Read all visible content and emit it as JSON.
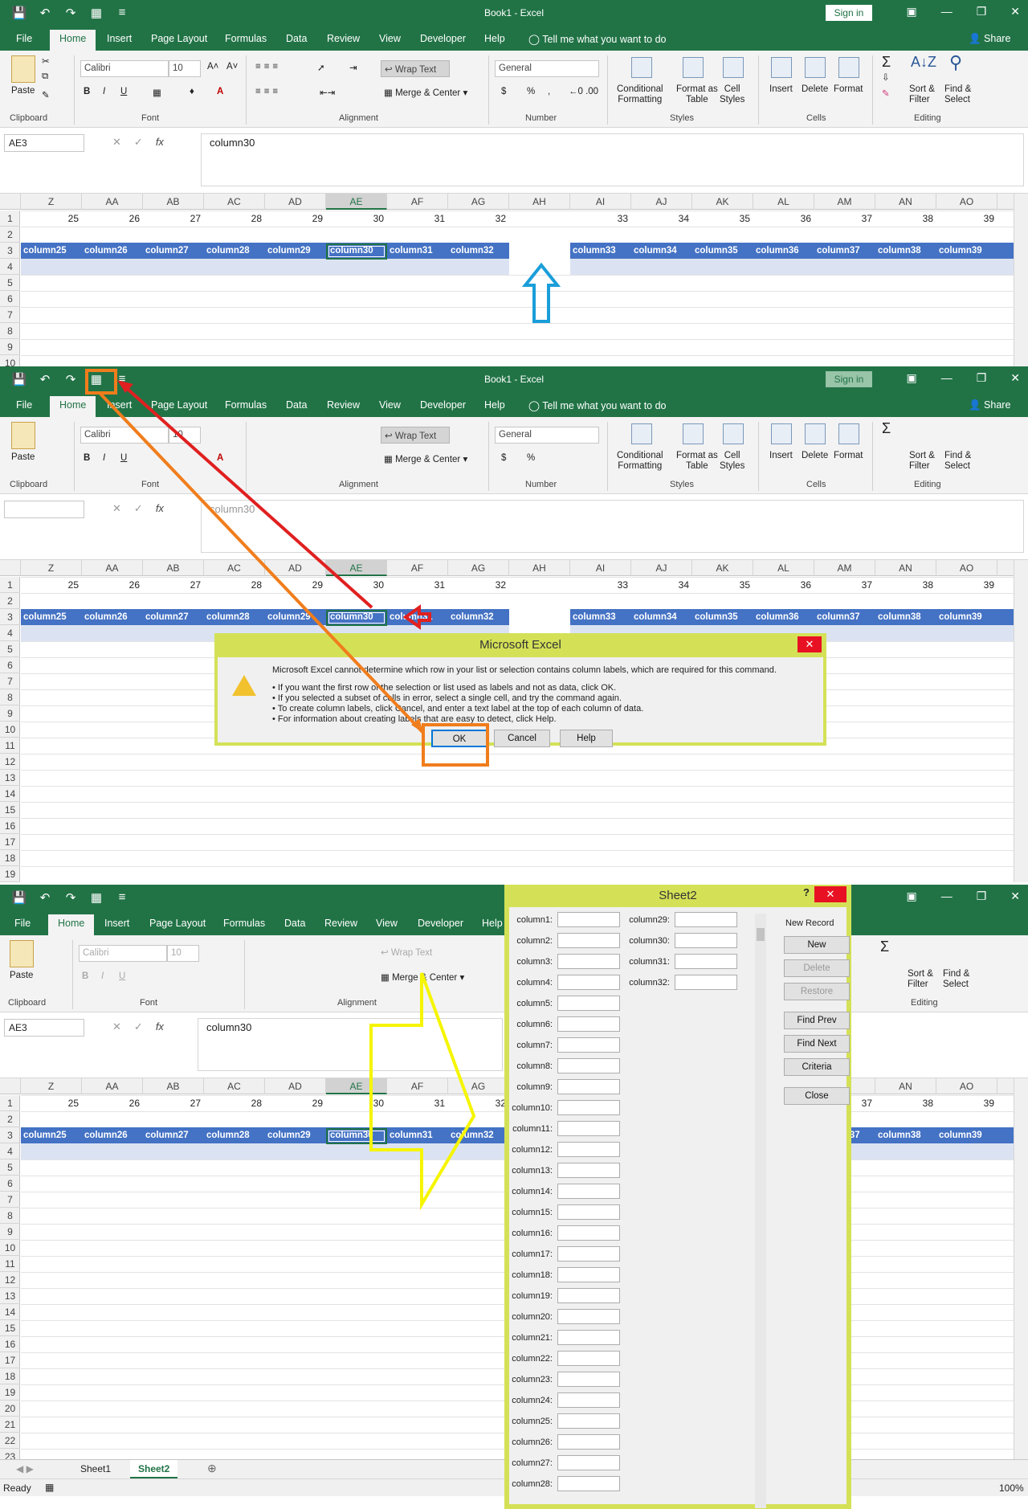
{
  "app": {
    "doc_title": "Book1  -  Excel",
    "sign_in": "Sign in",
    "share": "Share",
    "tell_me": "Tell me what you want to do",
    "tabs": [
      "File",
      "Home",
      "Insert",
      "Page Layout",
      "Formulas",
      "Data",
      "Review",
      "View",
      "Developer",
      "Help"
    ]
  },
  "ribbon": {
    "paste": "Paste",
    "font_name": "Calibri",
    "font_size": "10",
    "bold": "B",
    "italic": "I",
    "underline": "U",
    "wrap_text": "Wrap Text",
    "merge_center": "Merge & Center",
    "number_format": "General",
    "currency": "$",
    "percent": "%",
    "comma": ",",
    "conditional_formatting": [
      "Conditional",
      "Formatting"
    ],
    "format_as_table": [
      "Format as",
      "Table"
    ],
    "cell_styles": [
      "Cell",
      "Styles"
    ],
    "insert": "Insert",
    "delete": "Delete",
    "format": "Format",
    "sort_filter": [
      "Sort &",
      "Filter"
    ],
    "find_select": [
      "Find &",
      "Select"
    ],
    "groups": {
      "clipboard": "Clipboard",
      "font": "Font",
      "alignment": "Alignment",
      "number": "Number",
      "styles": "Styles",
      "cells": "Cells",
      "editing": "Editing"
    }
  },
  "formula_bar": {
    "name_box": "AE3",
    "fx": "fx",
    "content": "column30"
  },
  "grid": {
    "columns": [
      "Z",
      "AA",
      "AB",
      "AC",
      "AD",
      "AE",
      "AF",
      "AG",
      "AH",
      "AI",
      "AJ",
      "AK",
      "AL",
      "AM",
      "AN",
      "AO"
    ],
    "row1_values": [
      "25",
      "26",
      "27",
      "28",
      "29",
      "30",
      "31",
      "32",
      "",
      "33",
      "34",
      "35",
      "36",
      "37",
      "38",
      "39"
    ],
    "row3_labels": [
      "column25",
      "column26",
      "column27",
      "column28",
      "column29",
      "column30",
      "column31",
      "column32",
      "",
      "column33",
      "column34",
      "column35",
      "column36",
      "column37",
      "column38",
      "column39"
    ],
    "row_numbers_p1": [
      "1",
      "2",
      "3",
      "4",
      "5",
      "6",
      "7",
      "8",
      "9",
      "10"
    ],
    "row_numbers_p2": [
      "1",
      "2",
      "3",
      "4",
      "5",
      "6",
      "7",
      "8",
      "9",
      "10",
      "11",
      "12",
      "13",
      "14",
      "15",
      "16",
      "17",
      "18",
      "19"
    ],
    "row_numbers_p3": [
      "1",
      "2",
      "3",
      "4",
      "5",
      "6",
      "7",
      "8",
      "9",
      "10",
      "11",
      "12",
      "13",
      "14",
      "15",
      "16",
      "17",
      "18",
      "19",
      "20",
      "21",
      "22",
      "23"
    ]
  },
  "error_dialog": {
    "title": "Microsoft Excel",
    "main_text": "Microsoft Excel cannot determine which row in your list or selection contains column labels, which are required for this command.",
    "bullets": [
      "• If you want the first row of the selection or list used as labels and not as data, click OK.",
      "• If you selected a subset of cells in error, select a single cell, and try the command again.",
      "• To create column labels, click Cancel, and enter a text label at the top of each column of data.",
      "• For information about creating labels that are easy to detect, click Help."
    ],
    "ok": "OK",
    "cancel": "Cancel",
    "help": "Help"
  },
  "form_dialog": {
    "title": "Sheet2",
    "help_glyph": "?",
    "record_status": "New Record",
    "fields_left": [
      "column1:",
      "column2:",
      "column3:",
      "column4:",
      "column5:",
      "column6:",
      "column7:",
      "column8:",
      "column9:",
      "column10:",
      "column11:",
      "column12:",
      "column13:",
      "column14:",
      "column15:",
      "column16:",
      "column17:",
      "column18:",
      "column19:",
      "column20:",
      "column21:",
      "column22:",
      "column23:",
      "column24:",
      "column25:",
      "column26:",
      "column27:",
      "column28:"
    ],
    "fields_right": [
      "column29:",
      "column30:",
      "column31:",
      "column32:"
    ],
    "buttons": {
      "new": "New",
      "delete": "Delete",
      "restore": "Restore",
      "find_prev": "Find Prev",
      "find_next": "Find Next",
      "criteria": "Criteria",
      "close": "Close"
    }
  },
  "sheet_tabs": [
    "Sheet1",
    "Sheet2"
  ],
  "status": {
    "ready": "Ready",
    "zoom": "100%"
  },
  "annotation_colors": {
    "arrow_blue": "#1a9ed9",
    "arrow_red": "#e02020",
    "arrow_orange": "#f07d1c",
    "arrow_yellow": "#f5f500",
    "excel_green": "#217346",
    "header_blue": "#4472c4"
  }
}
